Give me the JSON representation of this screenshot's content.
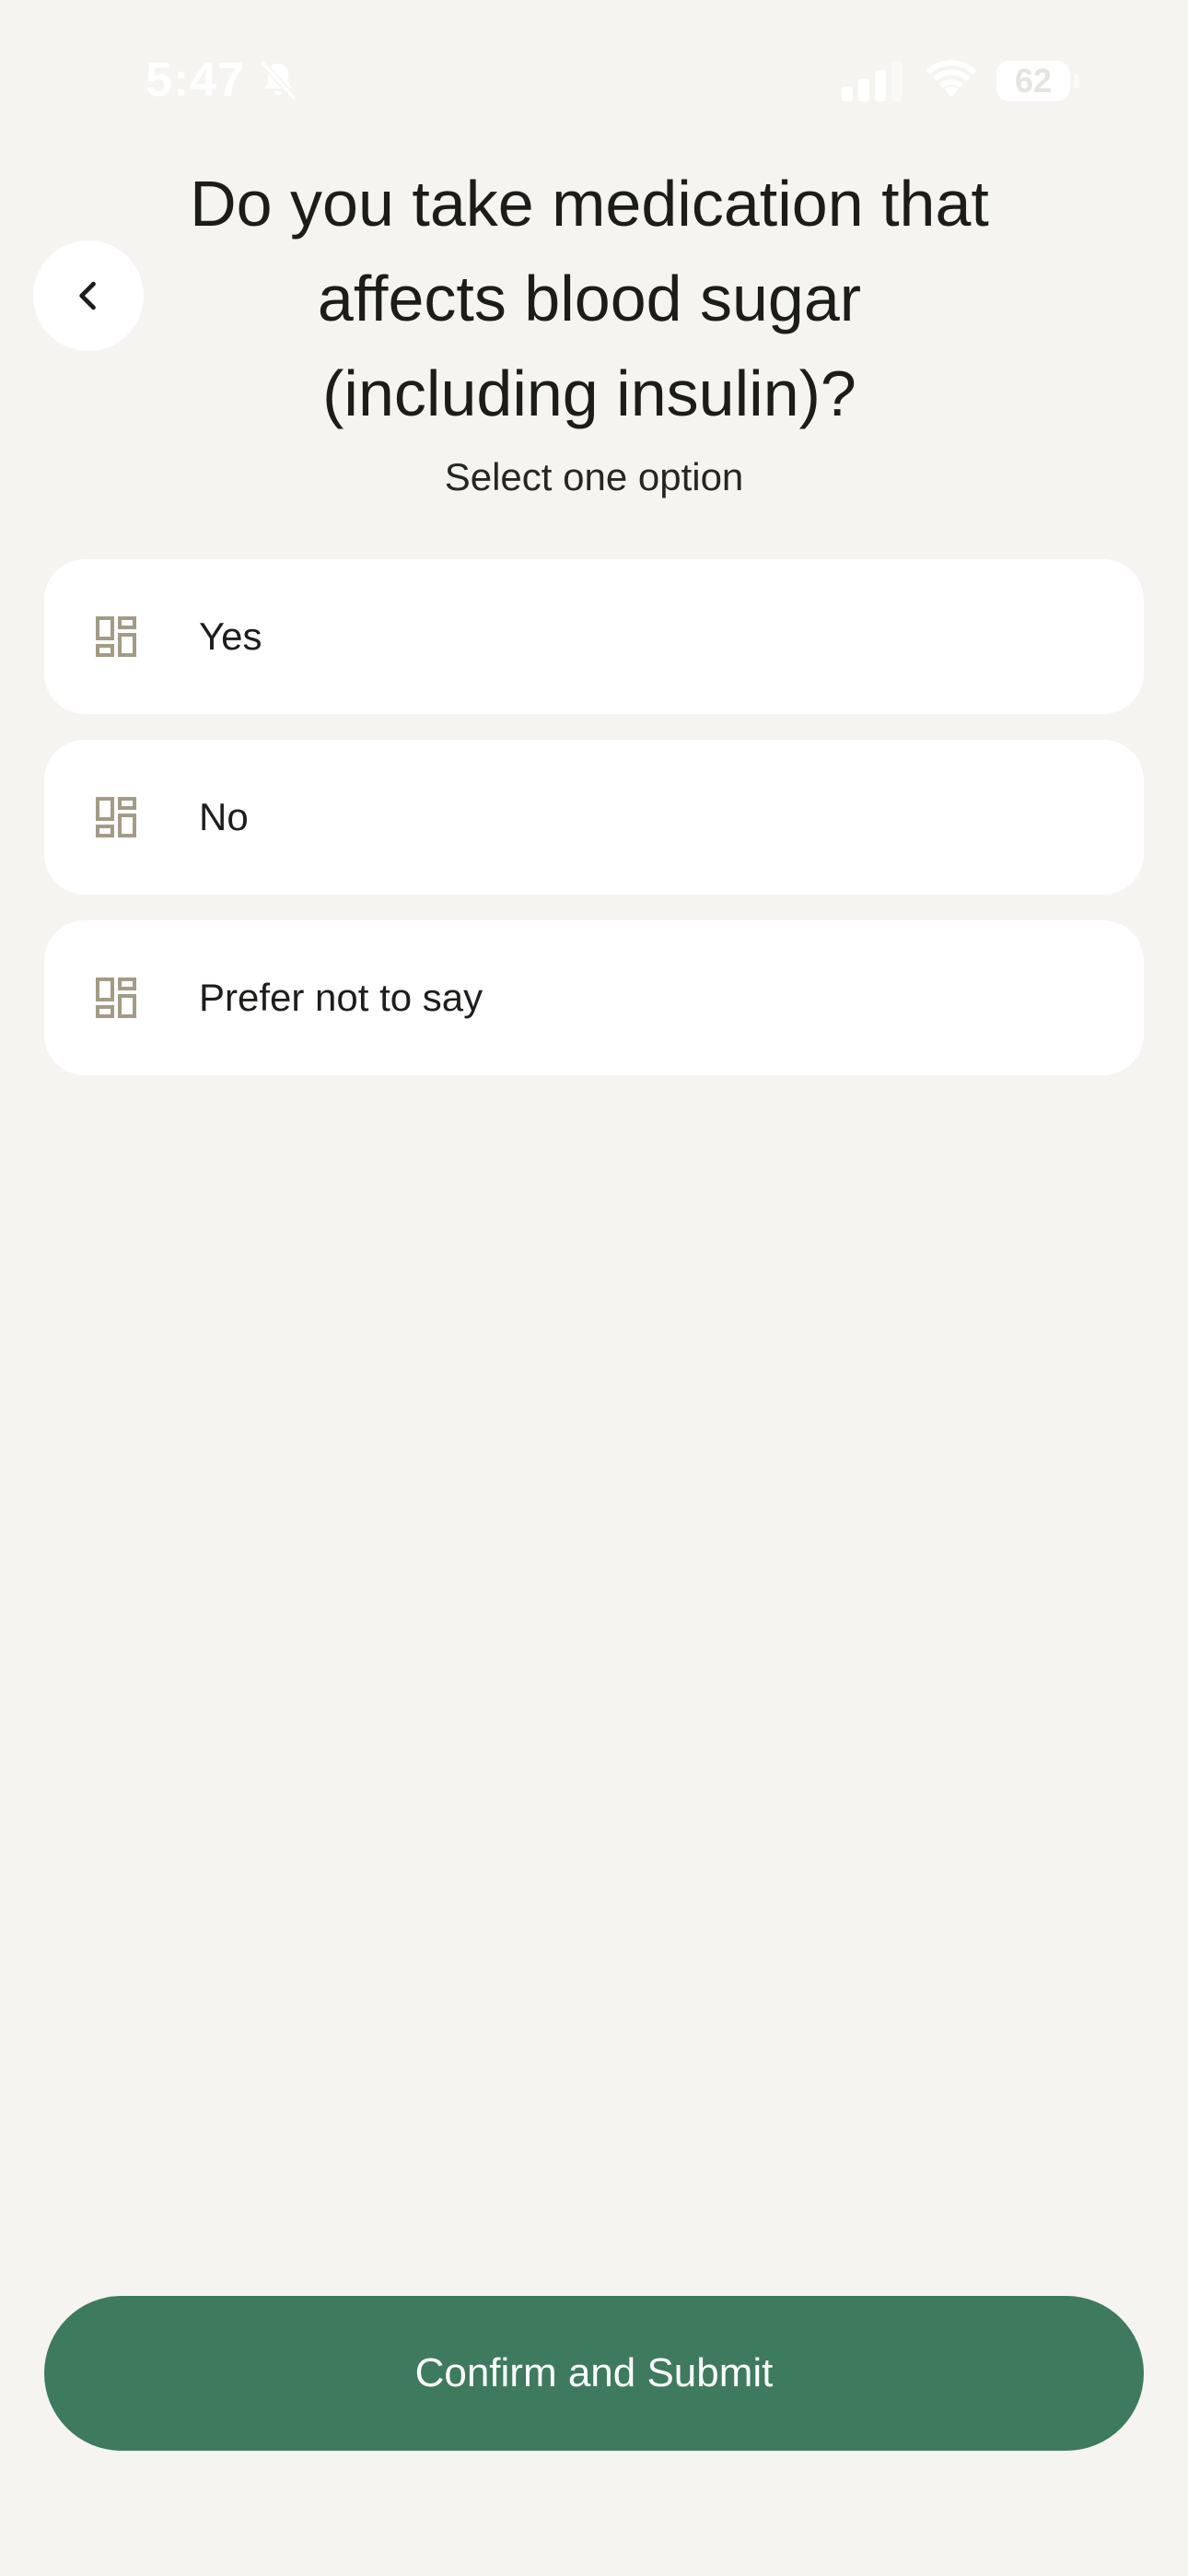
{
  "status_bar": {
    "time": "5:47",
    "battery_percent": "62",
    "battery_level": 0.62,
    "icons": [
      "bell-muted-icon",
      "cellular-signal-icon",
      "wifi-icon",
      "battery-icon"
    ]
  },
  "header": {
    "back_icon": "chevron-left-icon",
    "title": "Do you take medication that affects blood sugar (including insulin)?",
    "subtitle": "Select one option"
  },
  "options": [
    {
      "label": "Yes",
      "icon": "dashboard-grid-icon"
    },
    {
      "label": "No",
      "icon": "dashboard-grid-icon"
    },
    {
      "label": "Prefer not to say",
      "icon": "dashboard-grid-icon"
    }
  ],
  "submit": {
    "label": "Confirm and Submit"
  },
  "colors": {
    "background": "#f5f4f0",
    "card": "#ffffff",
    "accent": "#3d7a5e",
    "icon": "#a39b86",
    "text": "#1d1d1b"
  }
}
